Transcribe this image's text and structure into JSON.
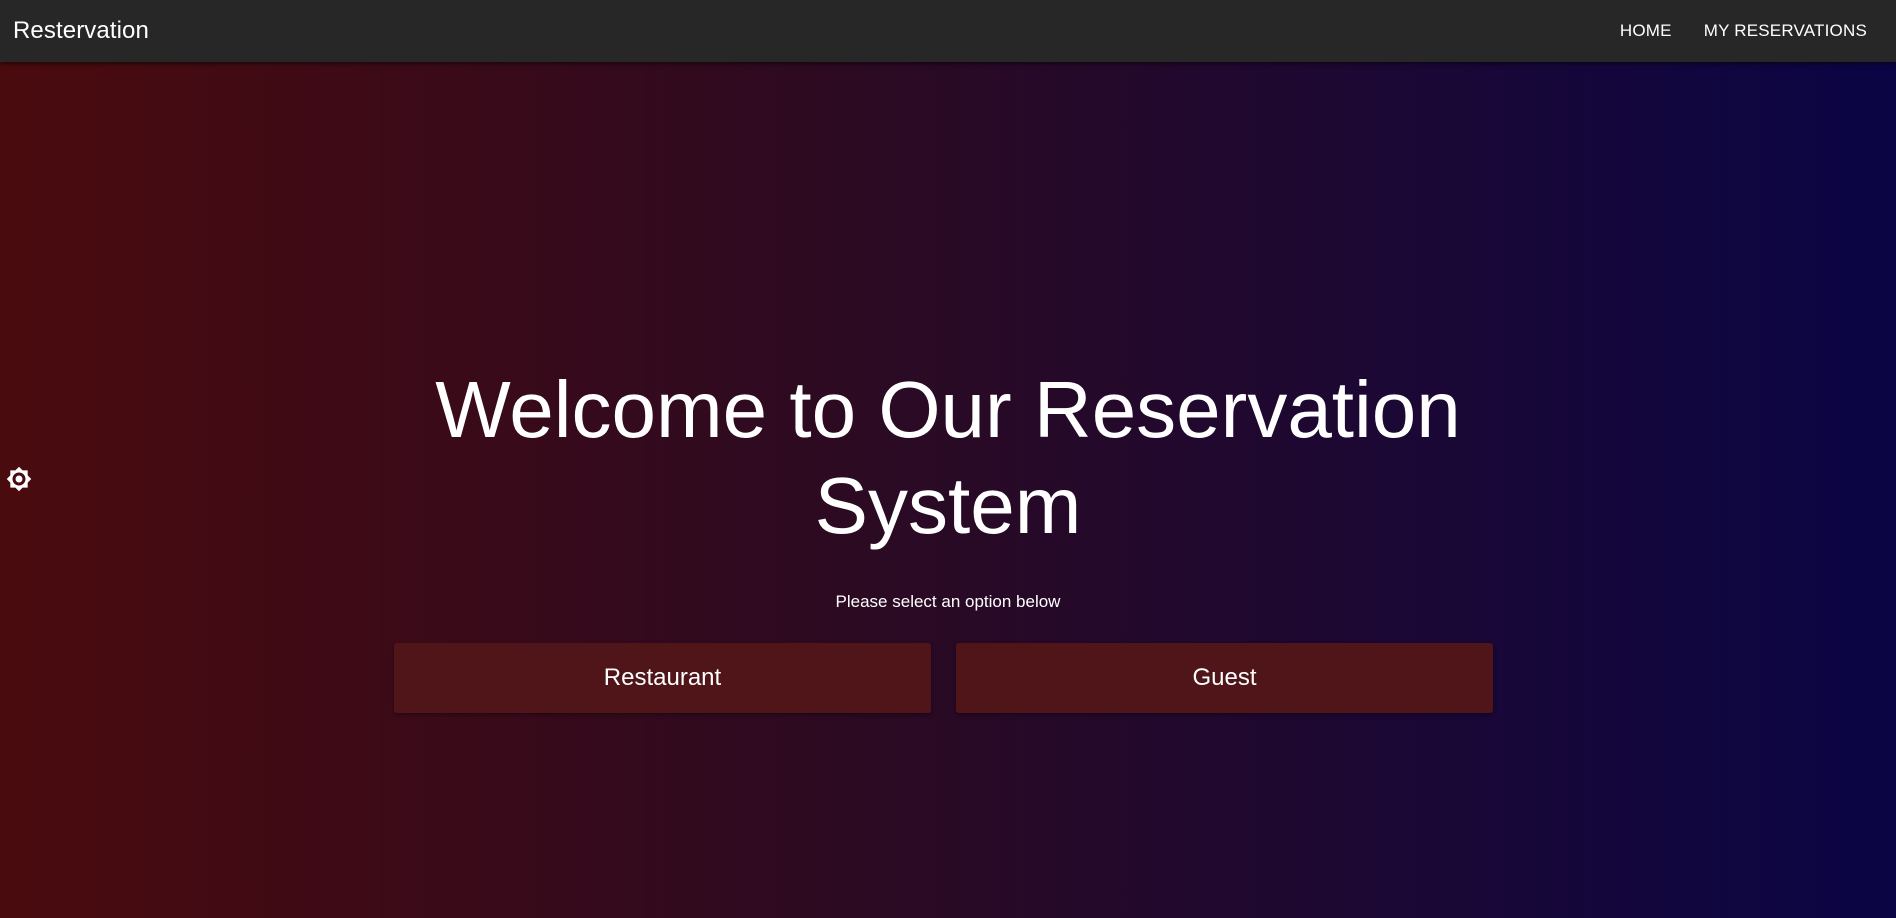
{
  "navbar": {
    "brand": "Restervation",
    "links": [
      {
        "label": "HOME"
      },
      {
        "label": "MY RESERVATIONS"
      }
    ]
  },
  "theme_toggle": {
    "icon": "brightness-icon"
  },
  "hero": {
    "title": "Welcome to Our Reservation System",
    "subtitle": "Please select an option below"
  },
  "options": [
    {
      "label": "Restaurant"
    },
    {
      "label": "Guest"
    }
  ],
  "colors": {
    "navbar_bg": "#272727",
    "gradient_start": "#4a0b0e",
    "gradient_end": "#0b0545",
    "button_bg": "#4f1519",
    "text": "#ffffff"
  }
}
